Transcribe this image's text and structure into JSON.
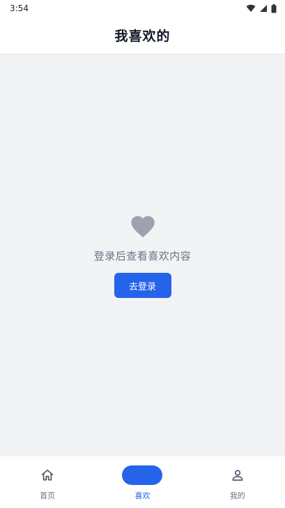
{
  "status_bar": {
    "time": "3:54",
    "icons": [
      "wifi-icon",
      "signal-icon",
      "battery-icon"
    ]
  },
  "header": {
    "title": "我喜欢的"
  },
  "empty_state": {
    "icon": "heart-icon",
    "message": "登录后查看喜欢内容",
    "button_label": "去登录"
  },
  "bottom_nav": {
    "items": [
      {
        "label": "首页",
        "icon": "home-icon",
        "active": false
      },
      {
        "label": "喜欢",
        "icon": "heart-icon",
        "active": true
      },
      {
        "label": "我的",
        "icon": "user-icon",
        "active": false
      }
    ]
  },
  "colors": {
    "accent": "#2563eb",
    "background": "#f2f3f5",
    "muted_text": "#6b7280",
    "heart_gray": "#9ca3af"
  }
}
